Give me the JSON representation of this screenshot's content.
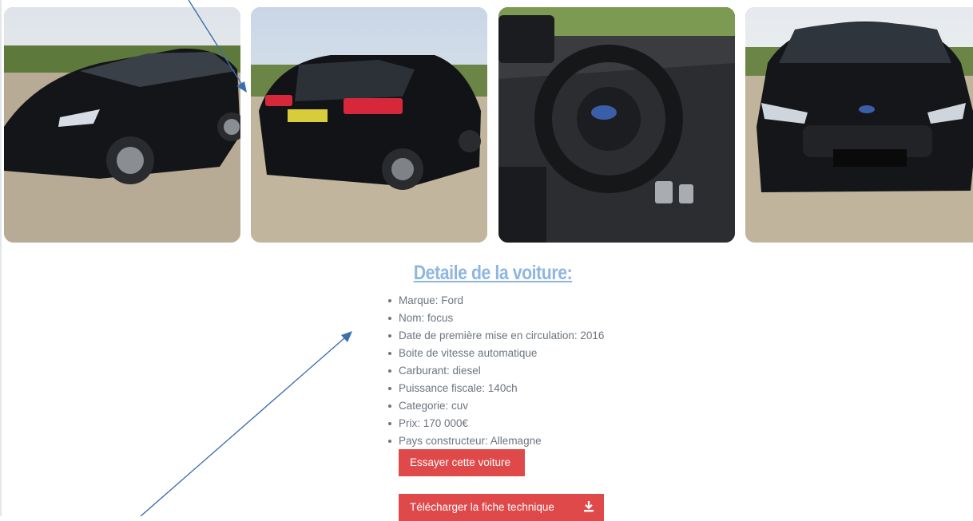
{
  "gallery": {
    "photos": [
      {
        "alt": "",
        "icon": "car-front-three-quarter-photo"
      },
      {
        "alt": "",
        "icon": "car-rear-photo"
      },
      {
        "alt": "",
        "icon": "car-interior-photo"
      },
      {
        "alt": "",
        "icon": "car-front-photo"
      }
    ]
  },
  "details": {
    "title": "Detaile de la voiture:",
    "specs": [
      "Marque: Ford",
      "Nom: focus",
      "Date de première mise en circulation: 2016",
      "Boite de vitesse automatique",
      "Carburant: diesel",
      "Puissance fiscale: 140ch",
      "Categorie: cuv",
      "Prix: 170 000€",
      "Pays constructeur: Allemagne"
    ]
  },
  "actions": {
    "try_label": "Essayer cette voiture",
    "download_label": "Télécharger la fiche technique",
    "download_icon": "download-icon"
  },
  "colors": {
    "title": "#8fb6e0",
    "button": "#e0494a",
    "annotation_arrow": "#3c6eb0"
  }
}
